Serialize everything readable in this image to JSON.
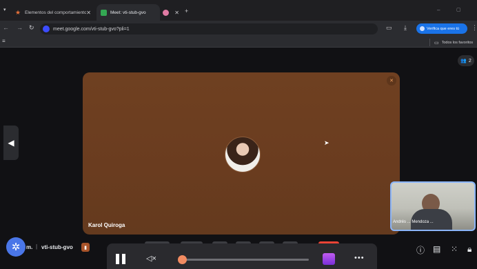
{
  "browser": {
    "tabs": [
      {
        "title": "Elementos del comportamiento",
        "favicon_color": "#e8713a",
        "active": false
      },
      {
        "title": "Meet: vti-stub-gvo",
        "favicon_color": "#34a853",
        "active": true
      },
      {
        "title": "",
        "favicon_color": "#e07aa3",
        "active": false
      }
    ],
    "new_tab_label": "+",
    "url": "meet.google.com/vti-stub-gvo?pli=1",
    "profile_button_label": "Verifica que eres tú",
    "bookmarks_label": "Todos los favoritos"
  },
  "meet": {
    "participant_count": "2",
    "main_participant_name": "Karol Quiroga",
    "self_view_name": "Andrés ... Mendoza ...",
    "meeting_time_fragment": "m.",
    "meeting_code": "vti-stub-gvo",
    "colors": {
      "tile": "#6b3e20",
      "accent": "#8ab4f8",
      "end_call": "#ea4335"
    }
  },
  "player": {
    "progress_knob_color": "#f28b61"
  },
  "icons": [
    "star-icon",
    "meet-icon",
    "close-icon",
    "back-icon",
    "forward-icon",
    "reload-icon",
    "site-info-icon",
    "bookmark-star-icon",
    "panel-icon",
    "download-icon",
    "menu-icon",
    "folder-icon",
    "people-icon",
    "muted-mic-icon",
    "chevron-left-icon",
    "gear-icon",
    "pause-icon",
    "mute-speaker-icon",
    "clapperboard-icon",
    "more-icon",
    "info-icon",
    "chat-icon",
    "apps-icon",
    "lock-icon"
  ]
}
